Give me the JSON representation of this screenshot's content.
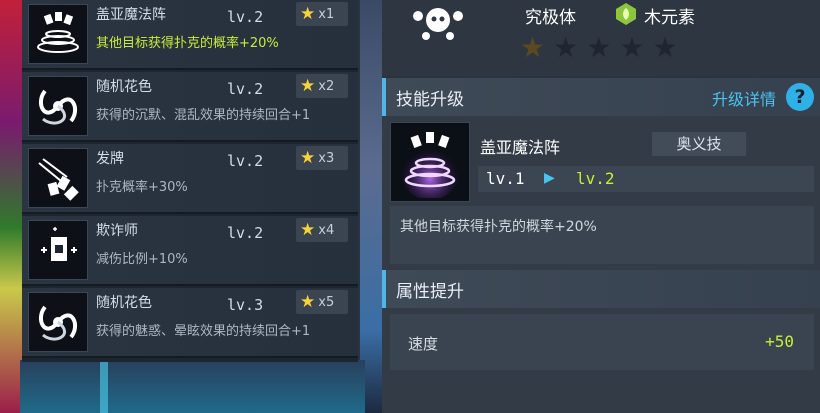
{
  "skills": [
    {
      "name": "盖亚魔法阵",
      "level": "lv.2",
      "stars": "x1",
      "desc": "其他目标获得扑克的概率+20%",
      "icon": "magic-circle-icon"
    },
    {
      "name": "随机花色",
      "level": "lv.2",
      "stars": "x2",
      "desc": "获得的沉默、混乱效果的持续回合+1",
      "icon": "spiral-icon"
    },
    {
      "name": "发牌",
      "level": "lv.2",
      "stars": "x3",
      "desc": "扑克概率+30%",
      "icon": "cards-throw-icon"
    },
    {
      "name": "欺诈师",
      "level": "lv.2",
      "stars": "x4",
      "desc": "减伤比例+10%",
      "icon": "card-trick-icon"
    },
    {
      "name": "随机花色",
      "level": "lv.3",
      "stars": "x5",
      "desc": "获得的魅惑、晕眩效果的持续回合+1",
      "icon": "spiral-icon"
    }
  ],
  "header": {
    "type_label": "究极体",
    "element_label": "木元素",
    "stars_filled": 1,
    "stars_total": 5
  },
  "upgrade": {
    "title": "技能升级",
    "details_link": "升级详情",
    "help": "?",
    "skill_name": "盖亚魔法阵",
    "skill_tag": "奥义技",
    "level_from": "lv.1",
    "level_to": "lv.2",
    "description": "其他目标获得扑克的概率+20%"
  },
  "attributes": {
    "title": "属性提升",
    "items": [
      {
        "name": "速度",
        "value": "+50"
      }
    ]
  },
  "colors": {
    "accent_blue": "#49c4ef",
    "accent_green": "#c8ee35",
    "star_gold": "#f6d33a"
  }
}
